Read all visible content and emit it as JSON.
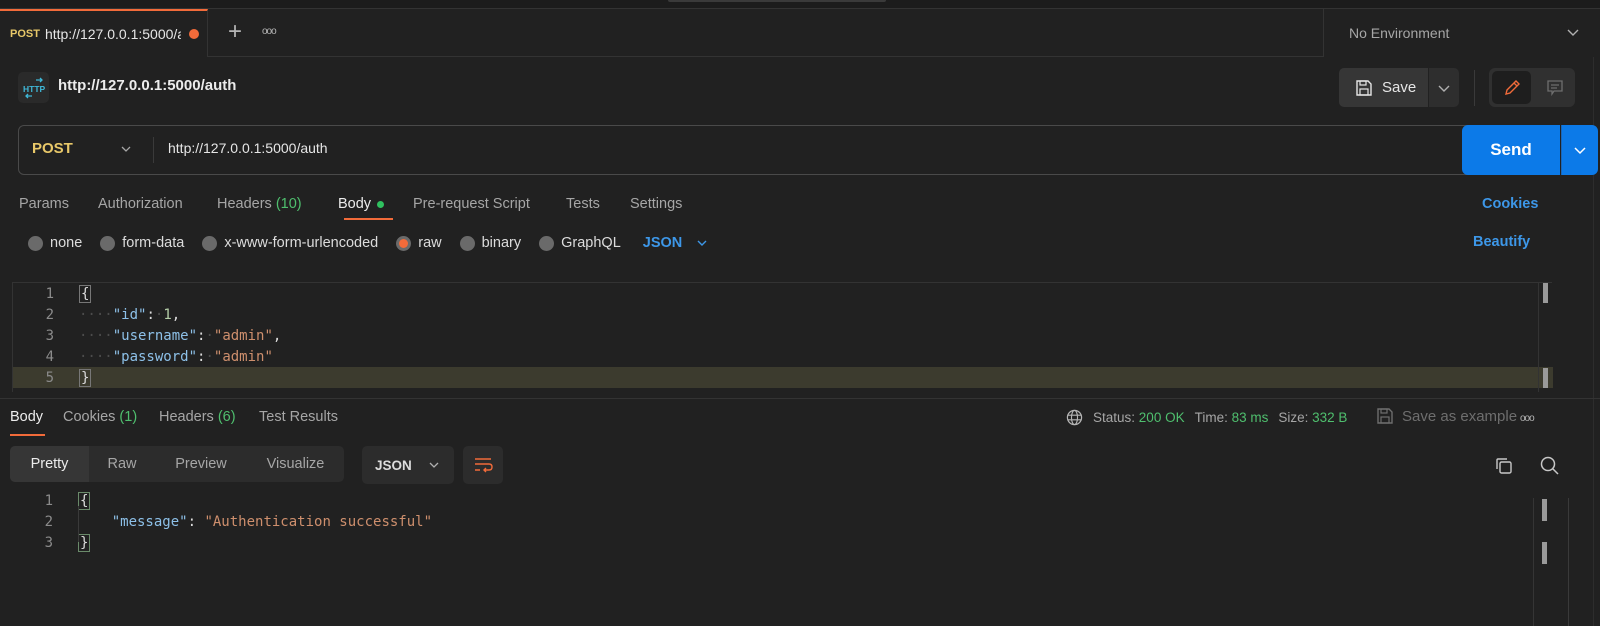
{
  "tabs": {
    "active": {
      "method": "POST",
      "title": "http://127.0.0.1:5000/a",
      "unsaved": true
    },
    "new_tab_label": "+",
    "more_label": "ooo"
  },
  "environment": {
    "selected": "No Environment"
  },
  "request": {
    "icon": "http-icon",
    "title": "http://127.0.0.1:5000/auth",
    "save_label": "Save",
    "method": "POST",
    "url": "http://127.0.0.1:5000/auth",
    "send_label": "Send"
  },
  "request_tabs": [
    {
      "label": "Params"
    },
    {
      "label": "Authorization"
    },
    {
      "label": "Headers",
      "count": "(10)"
    },
    {
      "label": "Body",
      "active": true,
      "indicator": true
    },
    {
      "label": "Pre-request Script"
    },
    {
      "label": "Tests"
    },
    {
      "label": "Settings"
    }
  ],
  "cookies_link": "Cookies",
  "body_types": [
    {
      "label": "none",
      "selected": false
    },
    {
      "label": "form-data",
      "selected": false
    },
    {
      "label": "x-www-form-urlencoded",
      "selected": false
    },
    {
      "label": "raw",
      "selected": true
    },
    {
      "label": "binary",
      "selected": false
    },
    {
      "label": "GraphQL",
      "selected": false
    }
  ],
  "body_language": "JSON",
  "beautify_label": "Beautify",
  "request_body": {
    "line_numbers": [
      "1",
      "2",
      "3",
      "4",
      "5"
    ],
    "lines": [
      {
        "open": "{"
      },
      {
        "key": "\"id\"",
        "value": "1",
        "type": "number",
        "trail": ","
      },
      {
        "key": "\"username\"",
        "value": "\"admin\"",
        "type": "string",
        "trail": ","
      },
      {
        "key": "\"password\"",
        "value": "\"admin\"",
        "type": "string",
        "trail": ""
      },
      {
        "close": "}"
      }
    ]
  },
  "response": {
    "tabs": [
      {
        "label": "Body",
        "active": true
      },
      {
        "label": "Cookies",
        "count": "(1)"
      },
      {
        "label": "Headers",
        "count": "(6)"
      },
      {
        "label": "Test Results"
      }
    ],
    "status_label": "Status:",
    "status_value": "200 OK",
    "time_label": "Time:",
    "time_value": "83 ms",
    "size_label": "Size:",
    "size_value": "332 B",
    "save_example_label": "Save as example",
    "more_label": "ooo",
    "views": [
      "Pretty",
      "Raw",
      "Preview",
      "Visualize"
    ],
    "active_view": "Pretty",
    "format": "JSON",
    "body": {
      "line_numbers": [
        "1",
        "2",
        "3"
      ],
      "open": "{",
      "key": "\"message\"",
      "value": "\"Authentication successful\"",
      "close": "}"
    }
  },
  "colors": {
    "accent_orange": "#f26b3a",
    "send_blue": "#0c7ae8",
    "link_blue": "#3d97e8",
    "method_yellow": "#e8c869",
    "success_green": "#4fbf6e"
  }
}
